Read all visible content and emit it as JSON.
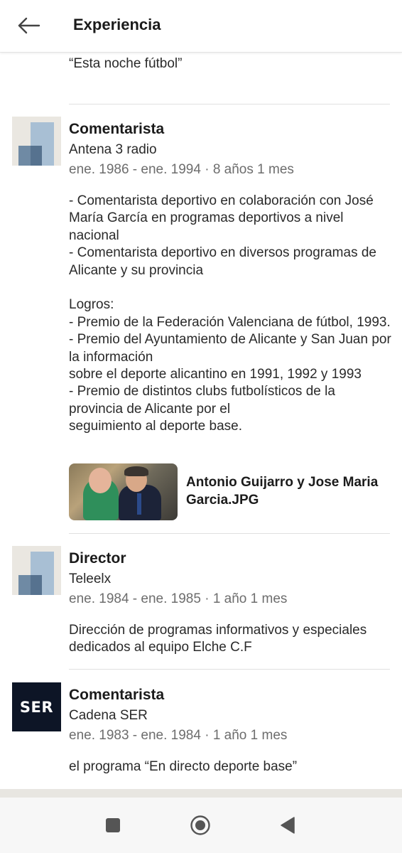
{
  "header": {
    "title": "Experiencia",
    "back_icon": "arrow-left-icon"
  },
  "partial_entry": {
    "text": "Dirección y presentación del programa deportivo “Esta noche fútbol”"
  },
  "entries": [
    {
      "role": "Comentarista",
      "company": "Antena 3 radio",
      "dates": "ene. 1986 - ene. 1994 · 8 años 1 mes",
      "description": "- Comentarista deportivo en colaboración con José María García en programas deportivos a nivel nacional\n- Comentarista deportivo en diversos programas de Alicante y su provincia\n\nLogros:\n- Premio de la Federación Valenciana de fútbol, 1993.\n- Premio del Ayuntamiento de Alicante y San Juan por la información\nsobre el deporte alicantino en 1991, 1992 y 1993\n- Premio de distintos clubs futbolísticos de la provincia de Alicante por el\nseguimiento al deporte base.",
      "media_title": "Antonio Guijarro y Jose Maria Garcia.JPG"
    },
    {
      "role": "Director",
      "company": "Teleelx",
      "dates": "ene. 1984 - ene. 1985 · 1 año 1 mes",
      "description": "Dirección de programas informativos y especiales dedicados al equipo Elche C.F"
    },
    {
      "role": "Comentarista",
      "company": "Cadena SER",
      "dates": "ene. 1983 - ene. 1984 · 1 año 1 mes",
      "description": "el programa “En directo deporte base”",
      "logo_text": "SER"
    }
  ],
  "navbar": {
    "icons": [
      "recent-apps-icon",
      "home-icon",
      "back-triangle-icon"
    ]
  },
  "colors": {
    "logo_dark": "#0d1526",
    "logo_light_blue": "#a8bfd4",
    "logo_mid_blue": "#6f8aa4",
    "dates_gray": "#6d6d6d"
  }
}
